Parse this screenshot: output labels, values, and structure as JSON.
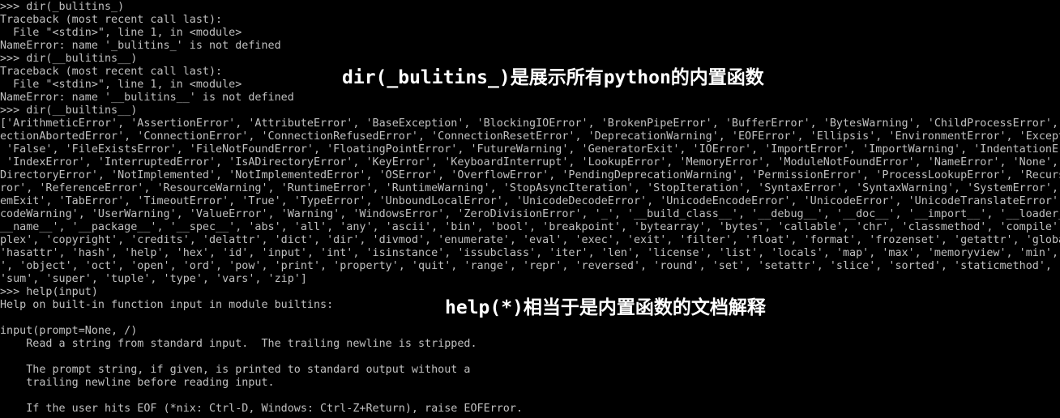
{
  "console": {
    "colors": {
      "background": "#000000",
      "text": "#c0c0c0",
      "caption": "#ffffff"
    },
    "lines": [
      ">>> dir(_bulitins_)",
      "Traceback (most recent call last):",
      "  File \"<stdin>\", line 1, in <module>",
      "NameError: name '_bulitins_' is not defined",
      ">>> dir(__bulitins__)",
      "Traceback (most recent call last):",
      "  File \"<stdin>\", line 1, in <module>",
      "NameError: name '__bulitins__' is not defined",
      ">>> dir(__builtins__)",
      "['ArithmeticError', 'AssertionError', 'AttributeError', 'BaseException', 'BlockingIOError', 'BrokenPipeError', 'BufferError', 'BytesWarning', 'ChildProcessError', 'C",
      "ectionAbortedError', 'ConnectionError', 'ConnectionRefusedError', 'ConnectionResetError', 'DeprecationWarning', 'EOFError', 'Ellipsis', 'EnvironmentError', 'Excepti",
      " 'False', 'FileExistsError', 'FileNotFoundError', 'FloatingPointError', 'FutureWarning', 'GeneratorExit', 'IOError', 'ImportError', 'ImportWarning', 'IndentationErr",
      " 'IndexError', 'InterruptedError', 'IsADirectoryError', 'KeyError', 'KeyboardInterrupt', 'LookupError', 'MemoryError', 'ModuleNotFoundError', 'NameError', 'None', '",
      "DirectoryError', 'NotImplemented', 'NotImplementedError', 'OSError', 'OverflowError', 'PendingDeprecationWarning', 'PermissionError', 'ProcessLookupError', 'Recursi",
      "ror', 'ReferenceError', 'ResourceWarning', 'RuntimeError', 'RuntimeWarning', 'StopAsyncIteration', 'StopIteration', 'SyntaxError', 'SyntaxWarning', 'SystemError', '",
      "emExit', 'TabError', 'TimeoutError', 'True', 'TypeError', 'UnboundLocalError', 'UnicodeDecodeError', 'UnicodeEncodeError', 'UnicodeError', 'UnicodeTranslateError',",
      "codeWarning', 'UserWarning', 'ValueError', 'Warning', 'WindowsError', 'ZeroDivisionError', '_', '__build_class__', '__debug__', '__doc__', '__import__', '__loader__",
      "__name__', '__package__', '__spec__', 'abs', 'all', 'any', 'ascii', 'bin', 'bool', 'breakpoint', 'bytearray', 'bytes', 'callable', 'chr', 'classmethod', 'compile',",
      "plex', 'copyright', 'credits', 'delattr', 'dict', 'dir', 'divmod', 'enumerate', 'eval', 'exec', 'exit', 'filter', 'float', 'format', 'frozenset', 'getattr', 'global",
      "'hasattr', 'hash', 'help', 'hex', 'id', 'input', 'int', 'isinstance', 'issubclass', 'iter', 'len', 'license', 'list', 'locals', 'map', 'max', 'memoryview', 'min', '",
      "', 'object', 'oct', 'open', 'ord', 'pow', 'print', 'property', 'quit', 'range', 'repr', 'reversed', 'round', 'set', 'setattr', 'slice', 'sorted', 'staticmethod', 's",
      "'sum', 'super', 'tuple', 'type', 'vars', 'zip']",
      ">>> help(input)",
      "Help on built-in function input in module builtins:",
      "",
      "input(prompt=None, /)",
      "    Read a string from standard input.  The trailing newline is stripped.",
      "",
      "    The prompt string, if given, is printed to standard output without a",
      "    trailing newline before reading input.",
      "",
      "    If the user hits EOF (*nix: Ctrl-D, Windows: Ctrl-Z+Return), raise EOFError."
    ]
  },
  "annotations": {
    "dir_caption": "dir(_bulitins_)是展示所有python的内置函数",
    "help_caption": "help(*)相当于是内置函数的文档解释"
  }
}
